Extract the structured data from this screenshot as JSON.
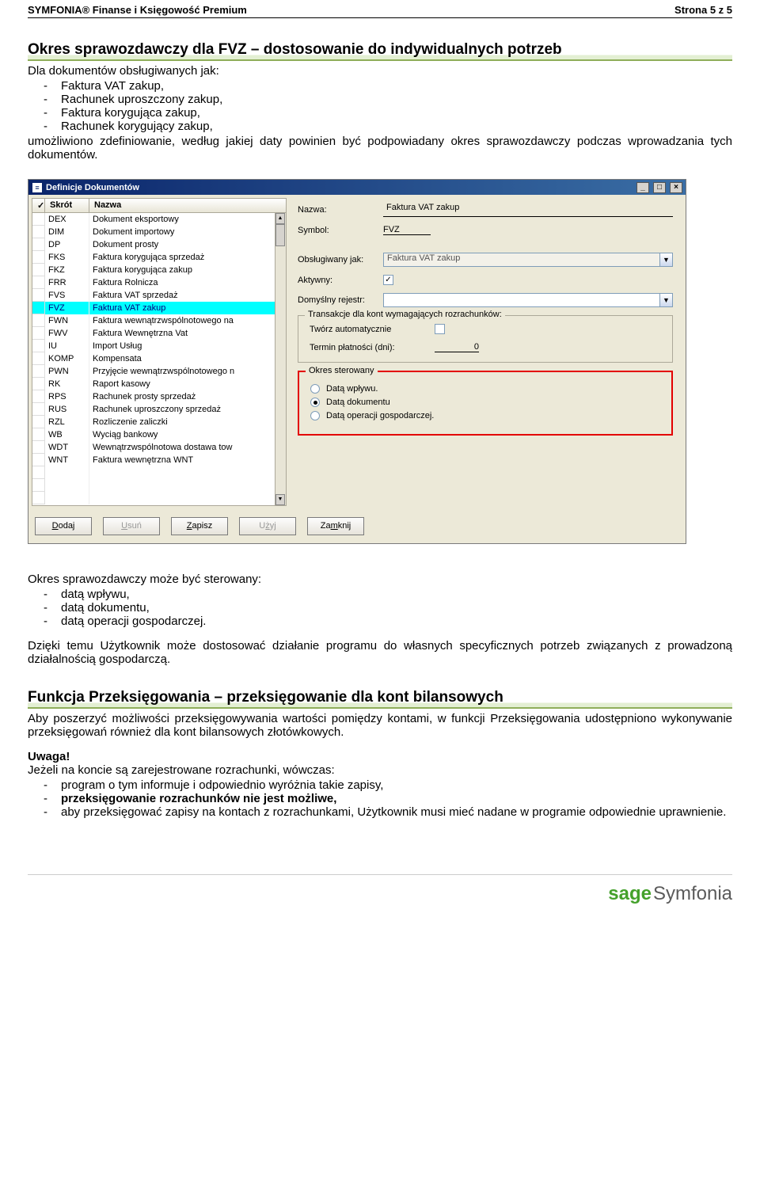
{
  "header": {
    "product": "SYMFONIA® Finanse i Księgowość Premium",
    "page": "Strona 5 z 5"
  },
  "section1": {
    "title": "Okres sprawozdawczy dla FVZ – dostosowanie do indywidualnych potrzeb",
    "intro": "Dla dokumentów obsługiwanych jak:",
    "docs": [
      "Faktura VAT zakup,",
      "Rachunek uproszczony zakup,",
      "Faktura korygująca zakup,",
      "Rachunek korygujący zakup,"
    ],
    "after": "umożliwiono zdefiniowanie, według jakiej daty powinien być podpowiadany okres sprawozdawczy podczas wprowadzania tych dokumentów."
  },
  "dialog": {
    "title": "Definicje Dokumentów",
    "listHeaders": {
      "check": "✓",
      "short": "Skrót",
      "name": "Nazwa"
    },
    "rows": [
      {
        "s": "DEX",
        "n": "Dokument eksportowy"
      },
      {
        "s": "DIM",
        "n": "Dokument importowy"
      },
      {
        "s": "DP",
        "n": "Dokument prosty"
      },
      {
        "s": "FKS",
        "n": "Faktura korygująca sprzedaż"
      },
      {
        "s": "FKZ",
        "n": "Faktura korygująca zakup"
      },
      {
        "s": "FRR",
        "n": "Faktura Rolnicza"
      },
      {
        "s": "FVS",
        "n": "Faktura VAT sprzedaż"
      },
      {
        "s": "FVZ",
        "n": "Faktura VAT zakup",
        "sel": true
      },
      {
        "s": "FWN",
        "n": "Faktura wewnątrzwspólnotowego na"
      },
      {
        "s": "FWV",
        "n": "Faktura Wewnętrzna Vat"
      },
      {
        "s": "IU",
        "n": "Import Usług"
      },
      {
        "s": "KOMP",
        "n": "Kompensata"
      },
      {
        "s": "PWN",
        "n": "Przyjęcie wewnątrzwspólnotowego n"
      },
      {
        "s": "RK",
        "n": "Raport kasowy"
      },
      {
        "s": "RPS",
        "n": "Rachunek prosty sprzedaż"
      },
      {
        "s": "RUS",
        "n": "Rachunek uproszczony sprzedaż"
      },
      {
        "s": "RZL",
        "n": "Rozliczenie zaliczki"
      },
      {
        "s": "WB",
        "n": "Wyciąg bankowy"
      },
      {
        "s": "WDT",
        "n": "Wewnątrzwspólnotowa dostawa tow"
      },
      {
        "s": "WNT",
        "n": "Faktura wewnętrzna WNT"
      }
    ],
    "labels": {
      "nazwa": "Nazwa:",
      "symbol": "Symbol:",
      "obslug": "Obsługiwany jak:",
      "aktywny": "Aktywny:",
      "rejestr": "Domyślny rejestr:"
    },
    "values": {
      "nazwa": "Faktura VAT zakup",
      "symbol": "FVZ",
      "obslug": "Faktura VAT zakup",
      "aktywny": true,
      "rejestr": ""
    },
    "trans": {
      "legend": "Transakcje dla kont wymagających rozrachunków:",
      "auto": "Twórz automatycznie",
      "term": "Termin płatności (dni):",
      "days": "0"
    },
    "okres": {
      "legend": "Okres sterowany",
      "opt1": "Datą wpływu.",
      "opt2": "Datą dokumentu",
      "opt3": "Datą operacji gospodarczej.",
      "selected": 2
    },
    "buttons": {
      "dodaj": "Dodaj",
      "usun": "Usuń",
      "zapisz": "Zapisz",
      "uzyj": "Użyj",
      "zamknij": "Zamknij"
    },
    "win": {
      "min": "_",
      "max": "□",
      "close": "×"
    }
  },
  "section1b": {
    "lead": "Okres sprawozdawczy może być sterowany:",
    "items": [
      "datą wpływu,",
      "datą dokumentu,",
      "datą operacji gospodarczej."
    ],
    "para": "Dzięki temu Użytkownik może dostosować działanie programu do własnych specyficznych potrzeb związanych z prowadzoną działalnością gospodarczą."
  },
  "section2": {
    "title": "Funkcja Przeksięgowania – przeksięgowanie dla kont bilansowych",
    "para": "Aby poszerzyć możliwości przeksięgowywania wartości pomiędzy kontami, w funkcji Przeksięgowania udostępniono wykonywanie przeksięgowań również dla kont bilansowych złotówkowych.",
    "uwaga": "Uwaga!",
    "uwagaLead": "Jeżeli na koncie są zarejestrowane rozrachunki, wówczas:",
    "items": [
      {
        "t": "program o tym informuje i odpowiednio wyróżnia takie zapisy,",
        "b": false
      },
      {
        "t": "przeksięgowanie rozrachunków nie jest możliwe,",
        "b": true
      },
      {
        "t": "aby przeksięgować zapisy na kontach z rozrachunkami, Użytkownik musi mieć nadane w programie odpowiednie uprawnienie.",
        "b": false
      }
    ]
  },
  "footer": {
    "sage": "sage",
    "symfonia": "Symfonia"
  }
}
